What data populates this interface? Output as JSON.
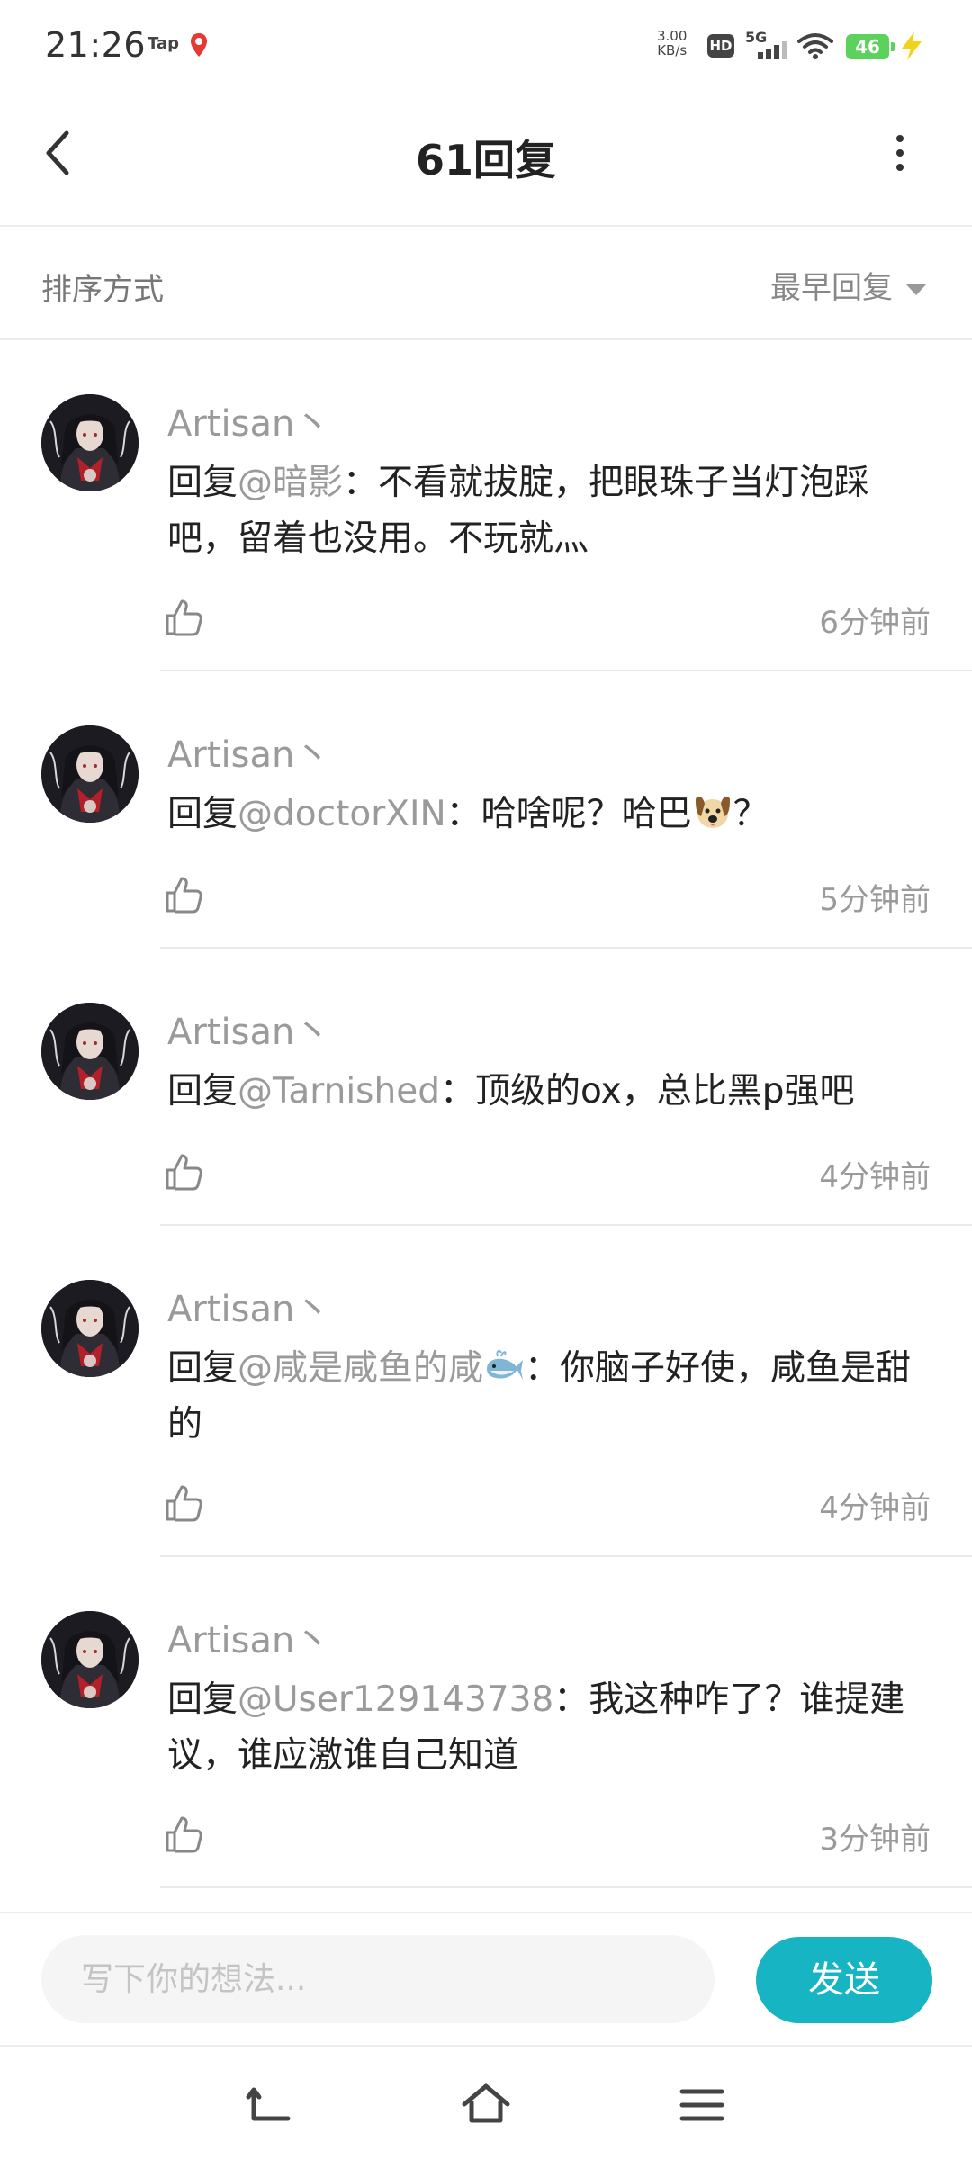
{
  "status_bar": {
    "time": "21:26",
    "tap_label": "Tap",
    "net_speed_value": "3.00",
    "net_speed_unit": "KB/s",
    "hd_label": "HD",
    "network_label": "5G",
    "battery_level": "46"
  },
  "header": {
    "title": "61回复"
  },
  "sort": {
    "label": "排序方式",
    "selected": "最早回复"
  },
  "comments": [
    {
      "author": "Artisan丶",
      "reply_prefix": "回复",
      "mention": "@暗影",
      "text": "：不看就拔腚，把眼珠子当灯泡踩吧，留着也没用。不玩就灬",
      "time": "6分钟前"
    },
    {
      "author": "Artisan丶",
      "reply_prefix": "回复",
      "mention": "@doctorXIN",
      "text": "：哈啥呢？哈巴",
      "emoji": "dog-face-emoji",
      "text_after": "？",
      "time": "5分钟前"
    },
    {
      "author": "Artisan丶",
      "reply_prefix": "回复",
      "mention": "@Tarnished",
      "text": "：顶级的ox，总比黑p强吧",
      "time": "4分钟前"
    },
    {
      "author": "Artisan丶",
      "reply_prefix": "回复",
      "mention": "@咸是咸鱼的咸",
      "mention_emoji": "whale-emoji",
      "text": "：你脑子好使，咸鱼是甜的",
      "time": "4分钟前"
    },
    {
      "author": "Artisan丶",
      "reply_prefix": "回复",
      "mention": "@User129143738",
      "text": "：我这种咋了？谁提建议，谁应激谁自己知道",
      "time": "3分钟前"
    }
  ],
  "input": {
    "placeholder": "写下你的想法..."
  },
  "send_button": {
    "label": "发送"
  },
  "colors": {
    "accent": "#17b4c4",
    "muted_text": "#9a9a9a",
    "battery": "#5bd25b",
    "bolt": "#f2d21a"
  },
  "icons": [
    "back-icon",
    "more-icon",
    "thumbs-up-icon",
    "nav-back-icon",
    "nav-home-icon",
    "nav-menu-icon"
  ]
}
